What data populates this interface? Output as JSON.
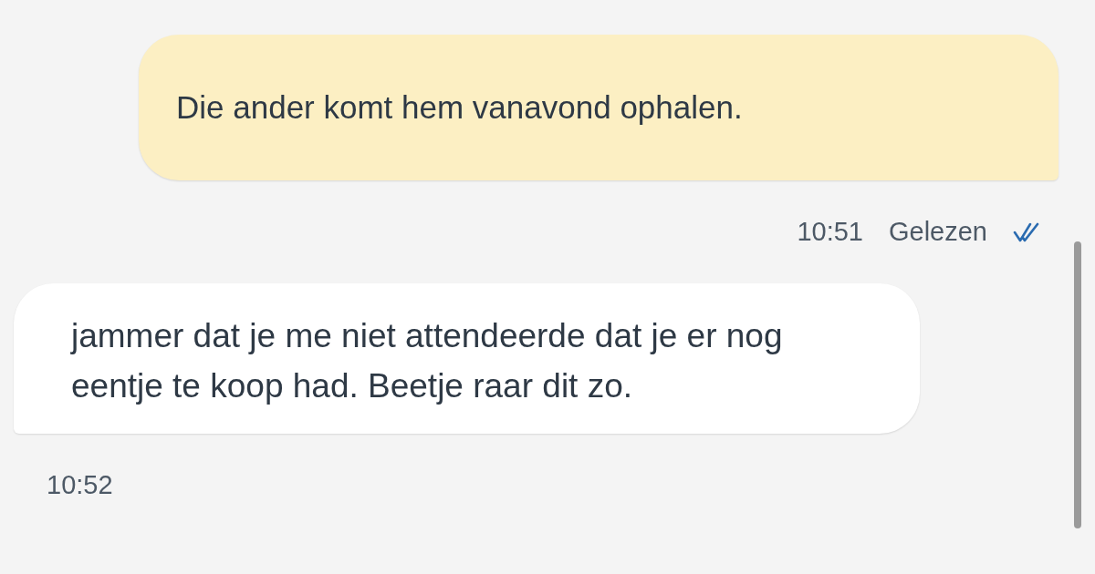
{
  "messages": [
    {
      "kind": "sent",
      "text": "Die ander komt hem vanavond ophalen.",
      "time": "10:51",
      "status": "Gelezen",
      "read": true
    },
    {
      "kind": "received",
      "text": "jammer dat je me niet attendeerde dat je er nog eentje te koop had. Beetje raar dit zo.",
      "time": "10:52"
    }
  ]
}
